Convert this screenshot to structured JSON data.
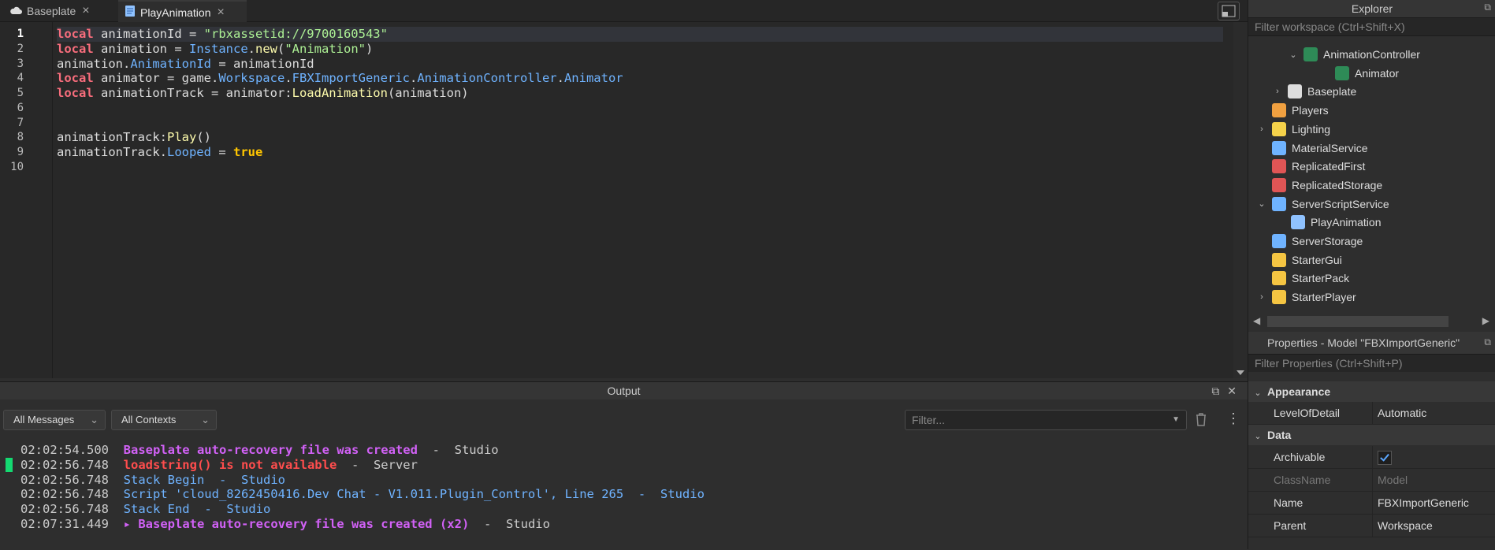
{
  "tabs": [
    {
      "label": "Baseplate",
      "icon": "cloud-icon"
    },
    {
      "label": "PlayAnimation",
      "icon": "script-icon"
    }
  ],
  "editor": {
    "line_numbers": [
      "1",
      "2",
      "3",
      "4",
      "5",
      "6",
      "7",
      "8",
      "9",
      "10"
    ],
    "lines": [
      "local animationId = \"rbxassetid://9700160543\"",
      "local animation = Instance.new(\"Animation\")",
      "animation.AnimationId = animationId",
      "local animator = game.Workspace.FBXImportGeneric.AnimationController.Animator",
      "local animationTrack = animator:LoadAnimation(animation)",
      "",
      "",
      "animationTrack:Play()",
      "animationTrack.Looped = true",
      ""
    ]
  },
  "output": {
    "title": "Output",
    "messages_filter": "All Messages",
    "contexts_filter": "All Contexts",
    "filter_placeholder": "Filter...",
    "messages": [
      {
        "time": "02:02:54.500",
        "text": "Baseplate auto-recovery file was created",
        "source": "Studio"
      },
      {
        "time": "02:02:56.748",
        "text": "loadstring() is not available",
        "source": "Server"
      },
      {
        "time": "02:02:56.748",
        "text": "Stack Begin",
        "source": "Studio"
      },
      {
        "time": "02:02:56.748",
        "text": "Script 'cloud_8262450416.Dev Chat - V1.011.Plugin_Control', Line 265",
        "source": "Studio"
      },
      {
        "time": "02:02:56.748",
        "text": "Stack End",
        "source": "Studio"
      },
      {
        "time": "02:07:31.449",
        "text": "Baseplate auto-recovery file was created (x2)",
        "source": "Studio"
      }
    ],
    "separator": "-"
  },
  "explorer": {
    "title": "Explorer",
    "filter_placeholder": "Filter workspace (Ctrl+Shift+X)",
    "items": [
      {
        "label": "AnimationController",
        "icon": "animation-controller-icon"
      },
      {
        "label": "Animator",
        "icon": "animator-icon"
      },
      {
        "label": "Baseplate",
        "icon": "part-icon"
      },
      {
        "label": "Players",
        "icon": "players-icon"
      },
      {
        "label": "Lighting",
        "icon": "lighting-icon"
      },
      {
        "label": "MaterialService",
        "icon": "material-service-icon"
      },
      {
        "label": "ReplicatedFirst",
        "icon": "replicated-first-icon"
      },
      {
        "label": "ReplicatedStorage",
        "icon": "replicated-storage-icon"
      },
      {
        "label": "ServerScriptService",
        "icon": "server-script-service-icon"
      },
      {
        "label": "PlayAnimation",
        "icon": "script-icon"
      },
      {
        "label": "ServerStorage",
        "icon": "server-storage-icon"
      },
      {
        "label": "StarterGui",
        "icon": "starter-gui-icon"
      },
      {
        "label": "StarterPack",
        "icon": "starter-pack-icon"
      },
      {
        "label": "StarterPlayer",
        "icon": "starter-player-icon"
      }
    ]
  },
  "properties": {
    "title": "Properties - Model \"FBXImportGeneric\"",
    "filter_placeholder": "Filter Properties (Ctrl+Shift+P)",
    "sections": [
      {
        "name": "Appearance",
        "rows": [
          {
            "key": "LevelOfDetail",
            "value": "Automatic"
          }
        ]
      },
      {
        "name": "Data",
        "rows": [
          {
            "key": "Archivable",
            "value": ""
          },
          {
            "key": "ClassName",
            "value": "Model"
          },
          {
            "key": "Name",
            "value": "FBXImportGeneric"
          },
          {
            "key": "Parent",
            "value": "Workspace"
          }
        ]
      }
    ]
  }
}
